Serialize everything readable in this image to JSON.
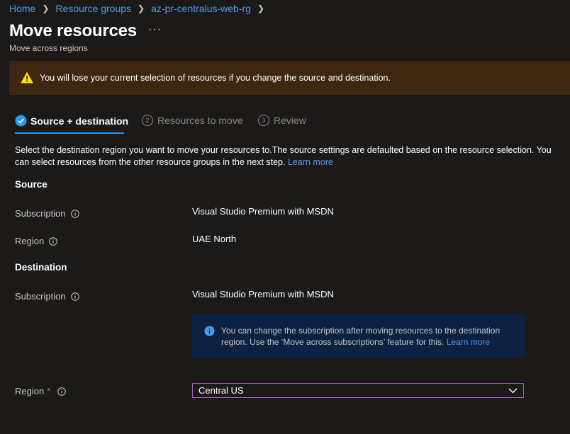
{
  "breadcrumb": {
    "items": [
      "Home",
      "Resource groups",
      "az-pr-centralus-web-rg"
    ]
  },
  "header": {
    "title": "Move resources",
    "more_label": "···",
    "subtitle": "Move across regions"
  },
  "warning": {
    "text": "You will lose your current selection of resources if you change the source and destination.",
    "icon": "warning-icon",
    "color": "#3e2711"
  },
  "steps": [
    {
      "number": "",
      "label": "Source + destination",
      "state": "active"
    },
    {
      "number": "2",
      "label": "Resources to move",
      "state": "inactive"
    },
    {
      "number": "3",
      "label": "Review",
      "state": "inactive"
    }
  ],
  "description": {
    "text": "Select the destination region you want to move your resources to.The source settings are defaulted based on the resource selection. You can select resources from the other resource groups in the next step.",
    "link": "Learn more"
  },
  "source": {
    "heading": "Source",
    "subscription_label": "Subscription",
    "subscription_value": "Visual Studio Premium with MSDN",
    "region_label": "Region",
    "region_value": "UAE North"
  },
  "destination": {
    "heading": "Destination",
    "subscription_label": "Subscription",
    "subscription_value": "Visual Studio Premium with MSDN",
    "info_text": "You can change the subscription after moving resources to the destination region. Use the ‘Move across subscriptions’ feature for this.",
    "info_link": "Learn more",
    "region_label": "Region",
    "region_required": "*",
    "region_value": "Central US"
  },
  "colors": {
    "accent": "#2899f5",
    "link": "#4f9bea",
    "warning_bg": "#3e2711",
    "info_bg": "#0e2142",
    "select_border": "#a45fbf"
  }
}
